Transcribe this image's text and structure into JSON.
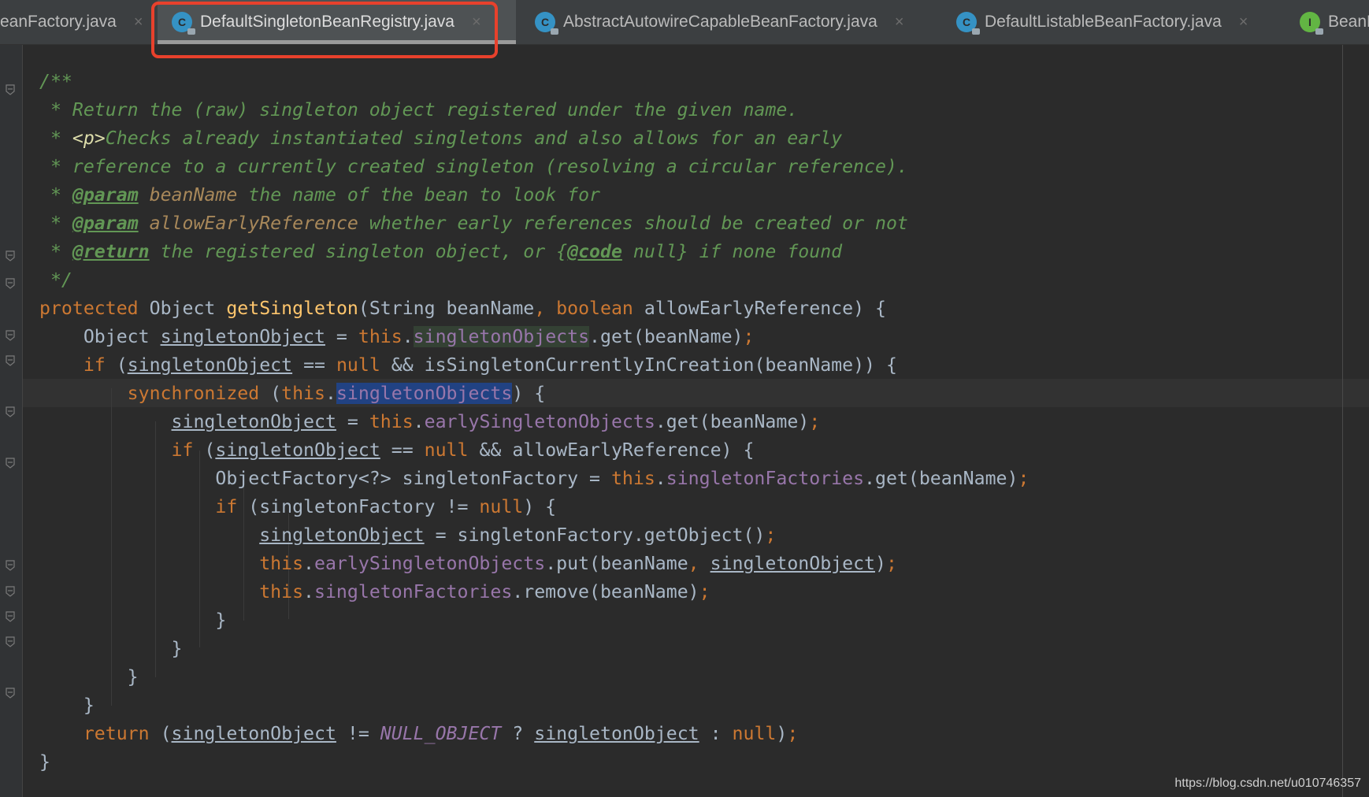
{
  "tabs": [
    {
      "label": "eanFactory.java",
      "icon": "class-icon",
      "active": false,
      "closable": true
    },
    {
      "label": "DefaultSingletonBeanRegistry.java",
      "icon": "class-icon",
      "active": true,
      "closable": true
    },
    {
      "label": "AbstractAutowireCapableBeanFactory.java",
      "icon": "class-icon",
      "active": false,
      "closable": true
    },
    {
      "label": "DefaultListableBeanFactory.java",
      "icon": "class-icon",
      "active": false,
      "closable": true
    },
    {
      "label": "BeanF",
      "icon": "interface-icon",
      "active": false,
      "closable": false
    }
  ],
  "tab_icon_letters": {
    "class": "C",
    "interface": "I"
  },
  "close_glyph": "×",
  "code_lines": [
    [
      [
        "cm",
        "/**"
      ]
    ],
    [
      [
        "cm",
        " * Return the (raw) singleton object registered under the given name."
      ]
    ],
    [
      [
        "cm",
        " * "
      ],
      [
        "ht",
        "<p>"
      ],
      [
        "cm",
        "Checks already instantiated singletons and also allows for an early"
      ]
    ],
    [
      [
        "cm",
        " * reference to a currently created singleton (resolving a circular reference)."
      ]
    ],
    [
      [
        "cm",
        " * "
      ],
      [
        "tag",
        "@param"
      ],
      [
        "cm",
        " "
      ],
      [
        "par",
        "beanName"
      ],
      [
        "cm",
        " the name of the bean to look for"
      ]
    ],
    [
      [
        "cm",
        " * "
      ],
      [
        "tag",
        "@param"
      ],
      [
        "cm",
        " "
      ],
      [
        "par",
        "allowEarlyReference"
      ],
      [
        "cm",
        " whether early references should be created or not"
      ]
    ],
    [
      [
        "cm",
        " * "
      ],
      [
        "tag",
        "@return"
      ],
      [
        "cm",
        " the registered singleton object, or {"
      ],
      [
        "tag",
        "@code"
      ],
      [
        "cm",
        " null} if none found"
      ]
    ],
    [
      [
        "cm",
        " */"
      ]
    ],
    [
      [
        "kw",
        "protected "
      ],
      [
        "tx",
        "Object "
      ],
      [
        "fn",
        "getSingleton"
      ],
      [
        "tx",
        "(String beanName"
      ],
      [
        "kw",
        ", boolean "
      ],
      [
        "tx",
        "allowEarlyReference) {"
      ]
    ],
    [
      [
        "tx",
        "    Object "
      ],
      [
        "ul",
        "singletonObject"
      ],
      [
        "tx",
        " = "
      ],
      [
        "kw",
        "this"
      ],
      [
        "tx",
        "."
      ],
      [
        "fldhl",
        "singletonObjects"
      ],
      [
        "tx",
        ".get(beanName)"
      ],
      [
        "kw",
        ";"
      ]
    ],
    [
      [
        "kw",
        "    if "
      ],
      [
        "tx",
        "("
      ],
      [
        "ul",
        "singletonObject"
      ],
      [
        "tx",
        " == "
      ],
      [
        "kw",
        "null "
      ],
      [
        "tx",
        "&& isSingletonCurrentlyInCreation(beanName)) {"
      ]
    ],
    [
      [
        "kw",
        "        synchronized "
      ],
      [
        "tx",
        "("
      ],
      [
        "kw",
        "this"
      ],
      [
        "tx",
        "."
      ],
      [
        "fldsel",
        "singletonObjects"
      ],
      [
        "tx",
        ") {"
      ]
    ],
    [
      [
        "tx",
        "            "
      ],
      [
        "ul",
        "singletonObject"
      ],
      [
        "tx",
        " = "
      ],
      [
        "kw",
        "this"
      ],
      [
        "tx",
        "."
      ],
      [
        "fld",
        "earlySingletonObjects"
      ],
      [
        "tx",
        ".get(beanName)"
      ],
      [
        "kw",
        ";"
      ]
    ],
    [
      [
        "kw",
        "            if "
      ],
      [
        "tx",
        "("
      ],
      [
        "ul",
        "singletonObject"
      ],
      [
        "tx",
        " == "
      ],
      [
        "kw",
        "null "
      ],
      [
        "tx",
        "&& allowEarlyReference) {"
      ]
    ],
    [
      [
        "tx",
        "                ObjectFactory<?> singletonFactory = "
      ],
      [
        "kw",
        "this"
      ],
      [
        "tx",
        "."
      ],
      [
        "fld",
        "singletonFactories"
      ],
      [
        "tx",
        ".get(beanName)"
      ],
      [
        "kw",
        ";"
      ]
    ],
    [
      [
        "kw",
        "                if "
      ],
      [
        "tx",
        "(singletonFactory != "
      ],
      [
        "kw",
        "null"
      ],
      [
        "tx",
        ") {"
      ]
    ],
    [
      [
        "tx",
        "                    "
      ],
      [
        "ul",
        "singletonObject"
      ],
      [
        "tx",
        " = singletonFactory.getObject()"
      ],
      [
        "kw",
        ";"
      ]
    ],
    [
      [
        "kw",
        "                    this"
      ],
      [
        "tx",
        "."
      ],
      [
        "fld",
        "earlySingletonObjects"
      ],
      [
        "tx",
        ".put(beanName"
      ],
      [
        "kw",
        ", "
      ],
      [
        "ul",
        "singletonObject"
      ],
      [
        "tx",
        ")"
      ],
      [
        "kw",
        ";"
      ]
    ],
    [
      [
        "kw",
        "                    this"
      ],
      [
        "tx",
        "."
      ],
      [
        "fld",
        "singletonFactories"
      ],
      [
        "tx",
        ".remove(beanName)"
      ],
      [
        "kw",
        ";"
      ]
    ],
    [
      [
        "tx",
        "                }"
      ]
    ],
    [
      [
        "tx",
        "            }"
      ]
    ],
    [
      [
        "tx",
        "        }"
      ]
    ],
    [
      [
        "tx",
        "    }"
      ]
    ],
    [
      [
        "kw",
        "    return "
      ],
      [
        "tx",
        "("
      ],
      [
        "ul",
        "singletonObject"
      ],
      [
        "tx",
        " != "
      ],
      [
        "cnst",
        "NULL_OBJECT"
      ],
      [
        "tx",
        " ? "
      ],
      [
        "ul",
        "singletonObject"
      ],
      [
        "tx",
        " : "
      ],
      [
        "kw",
        "null"
      ],
      [
        "tx",
        ")"
      ],
      [
        "kw",
        ";"
      ]
    ],
    [
      [
        "tx",
        "}"
      ]
    ]
  ],
  "watermark": "https://blog.csdn.net/u010746357",
  "colors": {
    "background": "#2b2b2b",
    "keyword": "#cc7832",
    "comment": "#629755",
    "method": "#ffc66d",
    "field": "#9876aa",
    "text": "#a9b7c6",
    "selection": "#214283",
    "highlight_box": "#e8412c"
  }
}
